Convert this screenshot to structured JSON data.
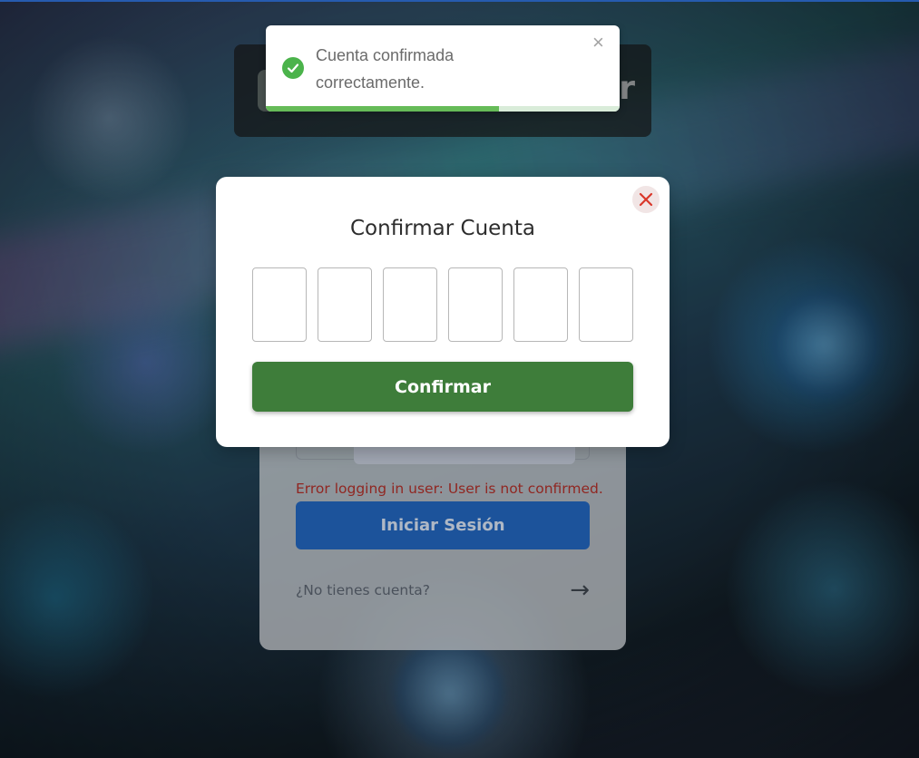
{
  "toast": {
    "message": "Cuenta confirmada correctamente.",
    "close_glyph": "×",
    "progress_fraction": 0.66,
    "icon": "check-circle-icon"
  },
  "header": {
    "partial_letter": "r"
  },
  "modal": {
    "title": "Confirmar Cuenta",
    "code_digits": [
      "",
      "",
      "",
      "",
      "",
      ""
    ],
    "confirm_label": "Confirmar",
    "close_icon": "close-icon"
  },
  "login": {
    "error_message": "Error logging in user: User is not confirmed.",
    "login_label": "Iniciar Sesión",
    "signup_prompt": "¿No tienes cuenta?",
    "arrow_glyph": "→"
  },
  "colors": {
    "confirm_button": "#3e7d3a",
    "login_button": "#2366bd",
    "error_text": "#b0302a",
    "toast_success": "#4bb34b",
    "close_icon": "#d9372a"
  }
}
